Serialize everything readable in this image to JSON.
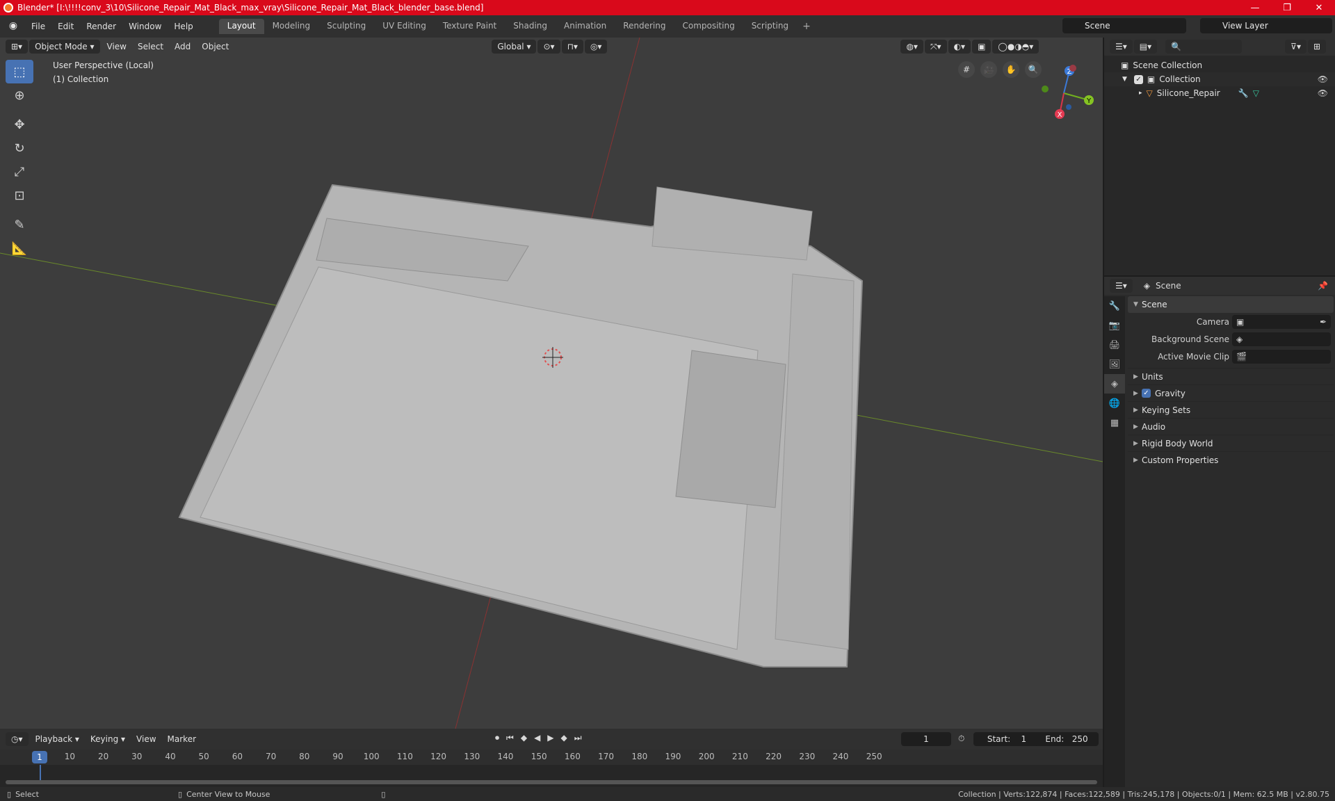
{
  "window": {
    "title": "Blender* [I:\\!!!!conv_3\\10\\Silicone_Repair_Mat_Black_max_vray\\Silicone_Repair_Mat_Black_blender_base.blend]",
    "minimize": "—",
    "maximize": "❐",
    "close": "✕"
  },
  "menu": [
    "File",
    "Edit",
    "Render",
    "Window",
    "Help"
  ],
  "workspaces": [
    "Layout",
    "Modeling",
    "Sculpting",
    "UV Editing",
    "Texture Paint",
    "Shading",
    "Animation",
    "Rendering",
    "Compositing",
    "Scripting"
  ],
  "workspace_add": "+",
  "scene_name": "Scene",
  "view_layer": "View Layer",
  "viewport": {
    "mode": "Object Mode",
    "menus": [
      "View",
      "Select",
      "Add",
      "Object"
    ],
    "orientation": "Global",
    "info_line1": "User Perspective (Local)",
    "info_line2": "(1) Collection",
    "gizmo": {
      "z": "Z",
      "y": "Y",
      "x": "X"
    }
  },
  "outliner": {
    "root": "Scene Collection",
    "collection": "Collection",
    "object": "Silicone_Repair"
  },
  "properties": {
    "header": "Scene",
    "panel": "Scene",
    "camera_label": "Camera",
    "background_label": "Background Scene",
    "movieclip_label": "Active Movie Clip",
    "subpanels": [
      "Units",
      "Gravity",
      "Keying Sets",
      "Audio",
      "Rigid Body World",
      "Custom Properties"
    ]
  },
  "timeline": {
    "menus": [
      "Playback",
      "Keying",
      "View",
      "Marker"
    ],
    "current_frame": "1",
    "start_label": "Start:",
    "start": "1",
    "end_label": "End:",
    "end": "250",
    "ticks": [
      "10",
      "20",
      "30",
      "40",
      "50",
      "60",
      "70",
      "80",
      "90",
      "100",
      "110",
      "120",
      "130",
      "140",
      "150",
      "160",
      "170",
      "180",
      "190",
      "200",
      "210",
      "220",
      "230",
      "240",
      "250"
    ]
  },
  "status": {
    "select": "Select",
    "center": "Center View to Mouse",
    "stats": "Collection | Verts:122,874 | Faces:122,589 | Tris:245,178 | Objects:0/1 | Mem: 62.5 MB | v2.80.75"
  }
}
